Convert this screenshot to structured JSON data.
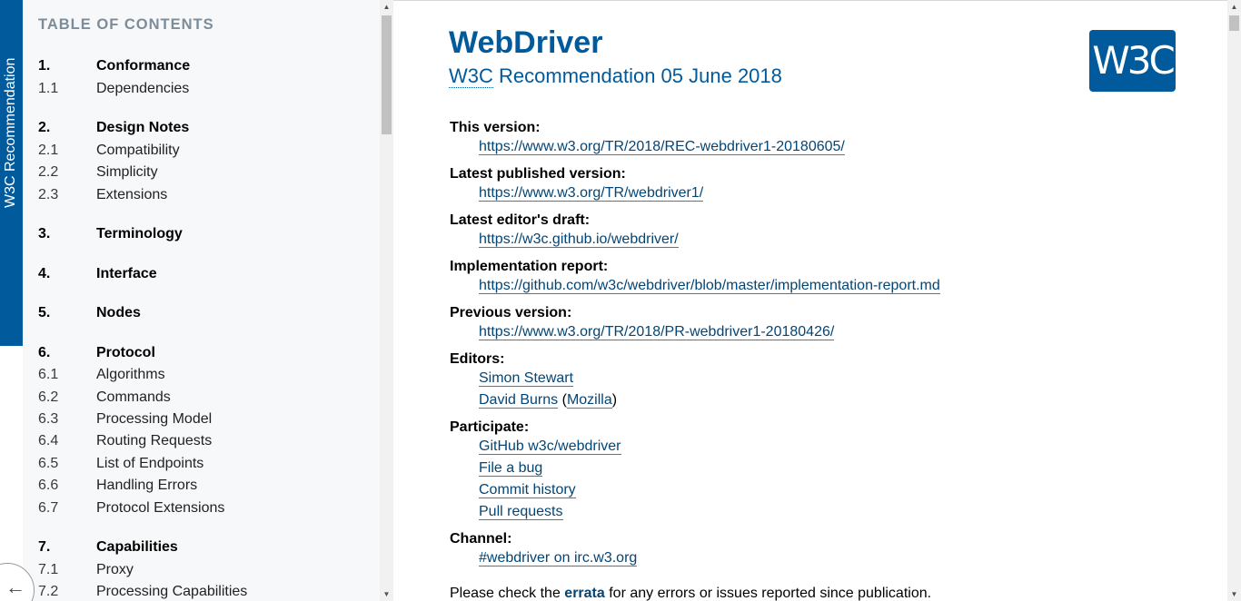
{
  "ribbon": {
    "label": "W3C Recommendation"
  },
  "toc": {
    "title": "TABLE OF CONTENTS",
    "items": [
      {
        "num": "1.",
        "label": "Conformance",
        "level": "sec"
      },
      {
        "num": "1.1",
        "label": "Dependencies",
        "level": "sub"
      },
      {
        "num": "2.",
        "label": "Design Notes",
        "level": "sec"
      },
      {
        "num": "2.1",
        "label": "Compatibility",
        "level": "sub"
      },
      {
        "num": "2.2",
        "label": "Simplicity",
        "level": "sub"
      },
      {
        "num": "2.3",
        "label": "Extensions",
        "level": "sub"
      },
      {
        "num": "3.",
        "label": "Terminology",
        "level": "sec"
      },
      {
        "num": "4.",
        "label": "Interface",
        "level": "sec"
      },
      {
        "num": "5.",
        "label": "Nodes",
        "level": "sec"
      },
      {
        "num": "6.",
        "label": "Protocol",
        "level": "sec"
      },
      {
        "num": "6.1",
        "label": "Algorithms",
        "level": "sub"
      },
      {
        "num": "6.2",
        "label": "Commands",
        "level": "sub"
      },
      {
        "num": "6.3",
        "label": "Processing Model",
        "level": "sub"
      },
      {
        "num": "6.4",
        "label": "Routing Requests",
        "level": "sub"
      },
      {
        "num": "6.5",
        "label": "List of Endpoints",
        "level": "sub"
      },
      {
        "num": "6.6",
        "label": "Handling Errors",
        "level": "sub"
      },
      {
        "num": "6.7",
        "label": "Protocol Extensions",
        "level": "sub"
      },
      {
        "num": "7.",
        "label": "Capabilities",
        "level": "sec"
      },
      {
        "num": "7.1",
        "label": "Proxy",
        "level": "sub"
      },
      {
        "num": "7.2",
        "label": "Processing Capabilities",
        "level": "sub"
      }
    ]
  },
  "back_to_top": {
    "glyph": "←"
  },
  "main": {
    "title": "WebDriver",
    "subtitle_abbr": "W3C",
    "subtitle_rest": " Recommendation 05 June 2018",
    "logo_text": "W3C",
    "this_version_label": "This version:",
    "this_version_url": "https://www.w3.org/TR/2018/REC-webdriver1-20180605/",
    "latest_published_label": "Latest published version:",
    "latest_published_url": "https://www.w3.org/TR/webdriver1/",
    "latest_draft_label": "Latest editor's draft:",
    "latest_draft_url": "https://w3c.github.io/webdriver/",
    "impl_report_label": "Implementation report:",
    "impl_report_url": "https://github.com/w3c/webdriver/blob/master/implementation-report.md",
    "previous_label": "Previous version:",
    "previous_url": "https://www.w3.org/TR/2018/PR-webdriver1-20180426/",
    "editors_label": "Editors:",
    "editor1": "Simon Stewart",
    "editor2": "David Burns",
    "editor2_org": "Mozilla",
    "participate_label": "Participate:",
    "participate1": "GitHub w3c/webdriver",
    "participate2": "File a bug",
    "participate3": "Commit history",
    "participate4": "Pull requests",
    "channel_label": "Channel:",
    "channel_link": "#webdriver on irc.w3.org",
    "errata_pre": "Please check the ",
    "errata_link": "errata",
    "errata_post": " for any errors or issues reported since publication."
  },
  "scroll_glyphs": {
    "up": "▲",
    "down": "▼"
  }
}
